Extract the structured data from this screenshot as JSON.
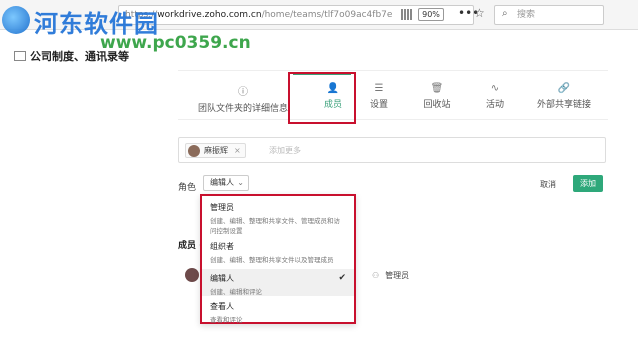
{
  "browser": {
    "url_prefix": "https://",
    "url_host": "workdrive.zoho.com.cn",
    "url_path": "/home/teams/tlf7o09ac4fb7e",
    "zoom": "90%",
    "search_placeholder": "搜索"
  },
  "watermark": {
    "brand": "河东软件园",
    "url": "www.pc0359.cn"
  },
  "team": {
    "name": "公司制度、通讯录等"
  },
  "tabs": [
    {
      "label": "团队文件夹的详细信息",
      "icon": "info-icon"
    },
    {
      "label": "成员",
      "icon": "members-icon"
    },
    {
      "label": "设置",
      "icon": "sliders-icon"
    },
    {
      "label": "回收站",
      "icon": "trash-icon"
    },
    {
      "label": "活动",
      "icon": "activity-icon"
    },
    {
      "label": "外部共享链接",
      "icon": "link-icon"
    }
  ],
  "invite": {
    "chip_name": "麻振辉",
    "placeholder": "添加更多"
  },
  "role": {
    "label": "角色",
    "value": "编辑人"
  },
  "actions": {
    "cancel": "取消",
    "add": "添加"
  },
  "members": {
    "label": "成员 (",
    "row_role": "管理员"
  },
  "dropdown": {
    "options": [
      {
        "title": "管理员",
        "desc": "创建、编辑、整理和共享文件、管理成员和访问控制设置"
      },
      {
        "title": "组织者",
        "desc": "创建、编辑、整理和共享文件以及管理成员"
      },
      {
        "title": "编辑人",
        "desc": "创建、编辑和评论",
        "selected": true
      },
      {
        "title": "查看人",
        "desc": "查看和评论"
      }
    ]
  },
  "colors": {
    "accent": "#2ea87a",
    "highlight": "#c8102e"
  }
}
